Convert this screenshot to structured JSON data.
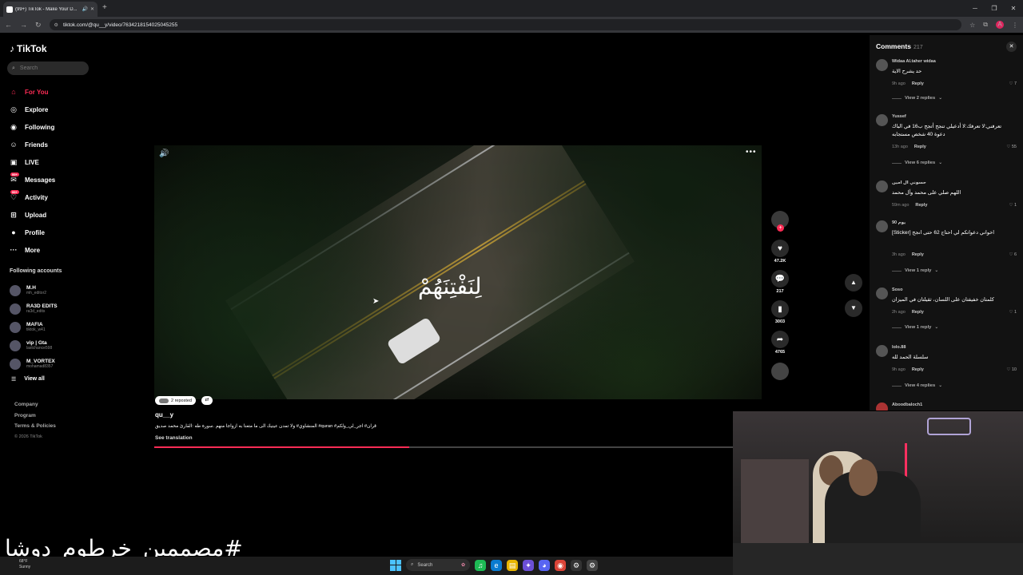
{
  "browser": {
    "tab_title": "(99+) TikTok - Make Your D...",
    "url": "tiktok.com/@qu__y/video/7634218154025045255",
    "profile_initial": "A"
  },
  "sidebar": {
    "brand": "TikTok",
    "search_placeholder": "Search",
    "nav": [
      {
        "label": "For You",
        "icon": "home-icon"
      },
      {
        "label": "Explore",
        "icon": "compass-icon"
      },
      {
        "label": "Following",
        "icon": "following-icon"
      },
      {
        "label": "Friends",
        "icon": "friends-icon"
      },
      {
        "label": "LIVE",
        "icon": "live-icon"
      },
      {
        "label": "Messages",
        "icon": "messages-icon",
        "badge": "99+"
      },
      {
        "label": "Activity",
        "icon": "activity-icon",
        "badge": "99+"
      },
      {
        "label": "Upload",
        "icon": "upload-icon"
      },
      {
        "label": "Profile",
        "icon": "profile-icon"
      },
      {
        "label": "More",
        "icon": "more-icon"
      }
    ],
    "following_title": "Following accounts",
    "accounts": [
      {
        "name": "M.H",
        "handle": "mh_editor2"
      },
      {
        "name": "RA3D EDITS",
        "handle": "ra3d_edits"
      },
      {
        "name": "MAFIA",
        "handle": "tiktok_w41"
      },
      {
        "name": "vip | Gta",
        "handle": "lastchance598"
      },
      {
        "name": "M_VORTEX",
        "handle": "mohamad8357"
      }
    ],
    "view_all": "View all",
    "footer": [
      "Company",
      "Program",
      "Terms & Policies"
    ],
    "copyright": "© 2026 TikTok"
  },
  "video": {
    "caption": "لِنَفْتِنَهُمْ",
    "reposted": "2 reposted",
    "author": "qu__y",
    "description": "قران# اجر_لي_ولكم# quran# المنشاوي# ولا تمدن عينيك الى ما متعنا به ازواجا منهم .سورة طه :القارئ محمد صديق",
    "see_translation": "See translation",
    "progress": 0.44
  },
  "actions": {
    "likes": "47.2K",
    "comments": "217",
    "saves": "3003",
    "shares": "4765"
  },
  "comments": {
    "title": "Comments",
    "count": "217",
    "reply_label": "Reply",
    "items": [
      {
        "user": "Widaa Al.taher widaa",
        "text": "حد يشرح الاية",
        "time": "9h ago",
        "likes": "7",
        "replies": "View 2 replies"
      },
      {
        "user": "Yussef",
        "text": "تعرفني:لا تعرفك:لا أدعيلي تنجح أتجح ب16 في الباك دعوة 40 شخص مستجابه",
        "time": "13h ago",
        "likes": "55",
        "replies": "View 6 replies"
      },
      {
        "user": "حسوني ال امين",
        "text": "اللهم صلي على محمد وآل محمد",
        "time": "59m ago",
        "likes": "1",
        "replies": ""
      },
      {
        "user": "يوم 90",
        "text": "اخواني دعواتكم لي احتاج 62 حتى انجح [Sticker]",
        "time": "3h ago",
        "likes": "6",
        "replies": "View 1 reply"
      },
      {
        "user": "Soso",
        "text": "كلمتان خفيفتان على اللسان، ثقيلتان في الميزان",
        "time": "2h ago",
        "likes": "1",
        "replies": "View 1 reply"
      },
      {
        "user": "lolo.88",
        "text": "سلسلة الحمد لله",
        "time": "9h ago",
        "likes": "10",
        "replies": "View 4 replies"
      },
      {
        "user": "Aboodbaloch1",
        "text": "",
        "time": "",
        "likes": "",
        "replies": ""
      }
    ]
  },
  "overlay_hashtag": "#مصممين_خرطوم_دوشا",
  "taskbar": {
    "weather_temp": "68°F",
    "weather_desc": "Sunny",
    "search_label": "Search"
  }
}
